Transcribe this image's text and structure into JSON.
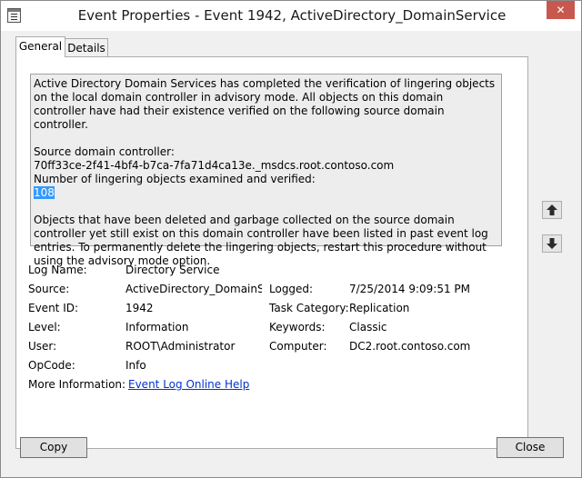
{
  "window": {
    "title": "Event Properties - Event 1942, ActiveDirectory_DomainService",
    "close_glyph": "✕"
  },
  "tabs": [
    {
      "label": "General"
    },
    {
      "label": "Details"
    }
  ],
  "description": {
    "para1": "Active Directory Domain Services has completed the verification of lingering objects on the local domain controller in advisory mode. All objects on this domain controller have had their existence verified on the following source domain controller.",
    "source_label": "Source domain controller:",
    "source_value": "70ff33ce-2f41-4bf4-b7ca-7fa71d4ca13e._msdcs.root.contoso.com",
    "count_label": "Number of lingering objects examined and verified:",
    "count_value": "108",
    "para2": "Objects that have been deleted and garbage collected on the source domain controller yet still exist on this domain controller have been listed in past event log entries. To permanently delete the lingering objects, restart this procedure without using the advisory mode option."
  },
  "fields": {
    "log_name": {
      "label": "Log Name:",
      "value": "Directory Service"
    },
    "source": {
      "label": "Source:",
      "value": "ActiveDirectory_DomainServ"
    },
    "logged": {
      "label": "Logged:",
      "value": "7/25/2014 9:09:51 PM"
    },
    "event_id": {
      "label": "Event ID:",
      "value": "1942"
    },
    "task_category": {
      "label": "Task Category:",
      "value": "Replication"
    },
    "level": {
      "label": "Level:",
      "value": "Information"
    },
    "keywords": {
      "label": "Keywords:",
      "value": "Classic"
    },
    "user": {
      "label": "User:",
      "value": "ROOT\\Administrator"
    },
    "computer": {
      "label": "Computer:",
      "value": "DC2.root.contoso.com"
    },
    "opcode": {
      "label": "OpCode:",
      "value": "Info"
    },
    "more_info": {
      "label": "More Information:",
      "value": "Event Log Online Help"
    }
  },
  "buttons": {
    "copy": "Copy",
    "close": "Close"
  },
  "colors": {
    "selection": "#3399ff",
    "link": "#0033cc",
    "close_button": "#c7584d",
    "up_arrow": "#2b2b2b",
    "down_arrow": "#2b2b2b"
  },
  "icons": {
    "window": "event-properties-icon",
    "up": "arrow-up-icon",
    "down": "arrow-down-icon"
  }
}
